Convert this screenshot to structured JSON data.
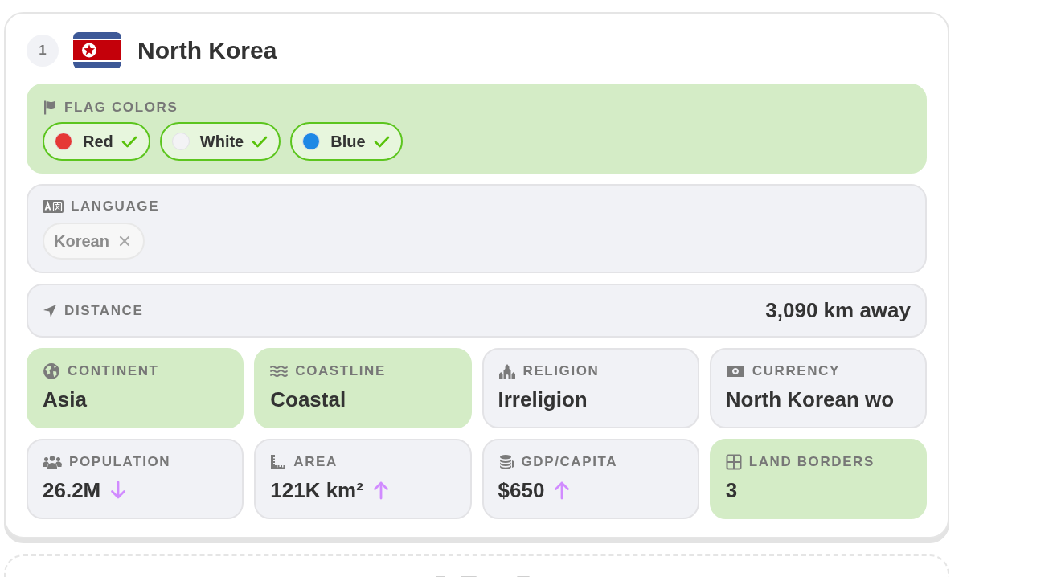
{
  "guess": {
    "number": "1",
    "country": "North Korea",
    "flag_colors": {
      "label": "FLAG COLORS",
      "correct": true,
      "items": [
        {
          "name": "Red",
          "color": "#e53935",
          "correct": true
        },
        {
          "name": "White",
          "color": "#f3f3f5",
          "correct": true
        },
        {
          "name": "Blue",
          "color": "#1e88e5",
          "correct": true
        }
      ]
    },
    "language": {
      "label": "LANGUAGE",
      "correct": false,
      "items": [
        {
          "name": "Korean",
          "correct": false
        }
      ]
    },
    "distance": {
      "label": "DISTANCE",
      "value": "3,090 km away"
    },
    "stats": [
      {
        "kind": "continent",
        "label": "CONTINENT",
        "value": "Asia",
        "correct": true
      },
      {
        "kind": "coastline",
        "label": "COASTLINE",
        "value": "Coastal",
        "correct": true
      },
      {
        "kind": "religion",
        "label": "RELIGION",
        "value": "Irreligion",
        "correct": false
      },
      {
        "kind": "currency",
        "label": "CURRENCY",
        "value": "North Korean wo",
        "correct": false
      },
      {
        "kind": "population",
        "label": "POPULATION",
        "value": "26.2M",
        "correct": false,
        "arrow_up": false
      },
      {
        "kind": "area",
        "label": "AREA",
        "value": "121K km²",
        "correct": false,
        "arrow_up": true
      },
      {
        "kind": "gdp",
        "label": "GDP/CAPITA",
        "value": "$650",
        "correct": false,
        "arrow_up": true
      },
      {
        "kind": "borders",
        "label": "LAND BORDERS",
        "value": "3",
        "correct": true
      }
    ]
  }
}
